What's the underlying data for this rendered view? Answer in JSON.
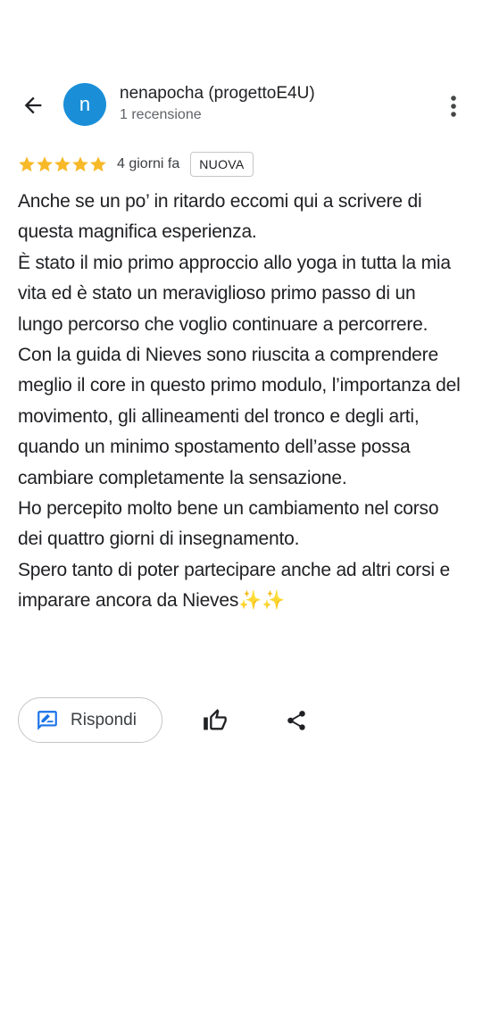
{
  "header": {
    "back_icon": "arrow-back-icon",
    "avatar_letter": "n",
    "avatar_color": "#1a8fd8",
    "author_name": "nenapocha (progettoE4U)",
    "author_review_count": "1 recensione",
    "more_icon": "more-vertical-icon"
  },
  "rating": {
    "stars": 5,
    "star_color": "#f7b928",
    "date": "4 giorni fa",
    "badge": "NUOVA"
  },
  "review": {
    "paragraphs": [
      "Anche se un po’ in ritardo eccomi qui a scrivere di questa magnifica esperienza.",
      "È stato il mio primo approccio allo yoga in tutta la mia vita ed è stato un meraviglioso primo passo di un lungo percorso che voglio continuare a percorrere.",
      "Con la guida di Nieves sono riuscita a comprendere meglio il core in questo primo modulo, l’importanza del movimento, gli allineamenti del tronco e degli arti, quando un minimo spostamento dell’asse possa cambiare completamente la sensazione.",
      "Ho percepito molto bene un cambiamento nel corso dei quattro giorni di insegnamento.",
      "Spero tanto di poter partecipare anche ad altri corsi e imparare ancora da Nieves✨✨"
    ]
  },
  "actions": {
    "reply_label": "Rispondi",
    "reply_icon": "rate-review-icon",
    "like_icon": "thumb-up-icon",
    "share_icon": "share-icon",
    "accent_color": "#1a73e8"
  }
}
